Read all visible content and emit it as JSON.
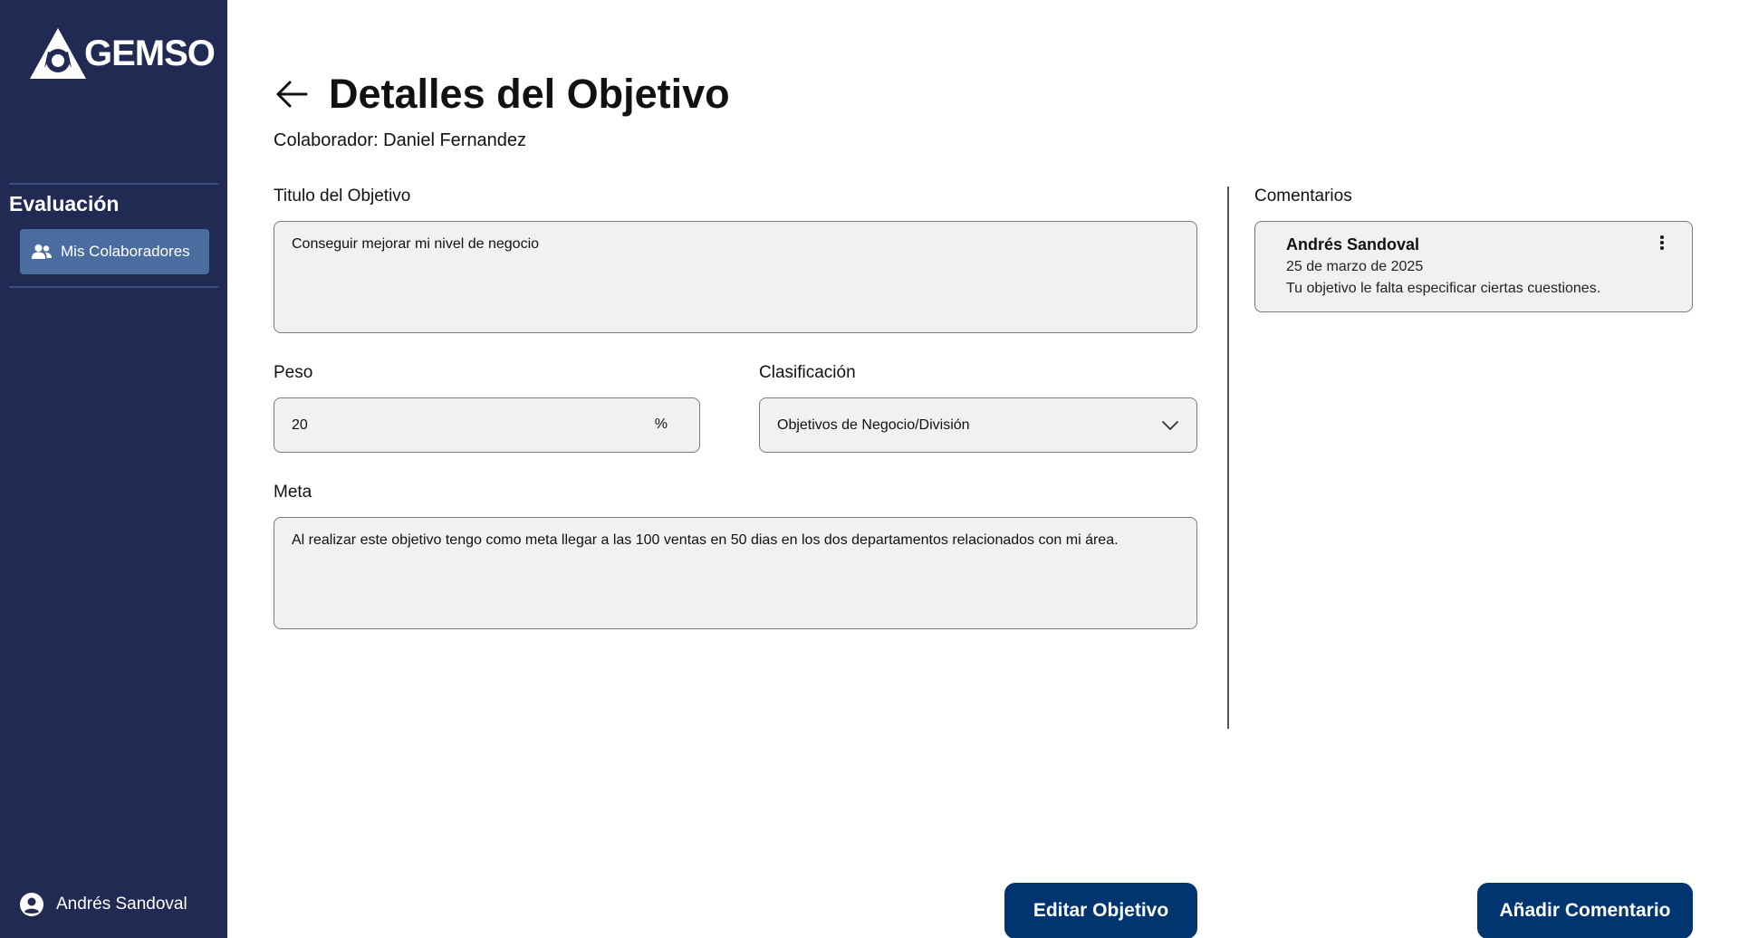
{
  "sidebar": {
    "logo_text": "GEMSO",
    "section_title": "Evaluación",
    "nav_item_label": "Mis Colaboradores",
    "user_name": "Andrés Sandoval"
  },
  "header": {
    "title": "Detalles del Objetivo",
    "collaborator": "Colaborador: Daniel Fernandez"
  },
  "form": {
    "titulo_label": "Titulo del Objetivo",
    "titulo_value": "Conseguir mejorar mi nivel de negocio",
    "peso_label": "Peso",
    "peso_value": "20",
    "peso_unit": "%",
    "clasificacion_label": "Clasificación",
    "clasificacion_value": "Objetivos de Negocio/División",
    "meta_label": "Meta",
    "meta_value": "Al realizar este objetivo tengo como meta llegar a las 100 ventas en 50 dias en los dos departamentos relacionados con mi área."
  },
  "comments": {
    "label": "Comentarios",
    "items": [
      {
        "author": "Andrés Sandoval",
        "date": "25 de marzo de 2025",
        "text": "Tu objetivo le falta especificar ciertas cuestiones."
      }
    ]
  },
  "actions": {
    "edit_label": "Editar Objetivo",
    "add_comment_label": "Añadir Comentario"
  },
  "colors": {
    "sidebar_bg": "#212a52",
    "nav_active_bg": "#4a6c9e",
    "button_bg": "#003570",
    "field_bg": "#f1f1f1"
  }
}
